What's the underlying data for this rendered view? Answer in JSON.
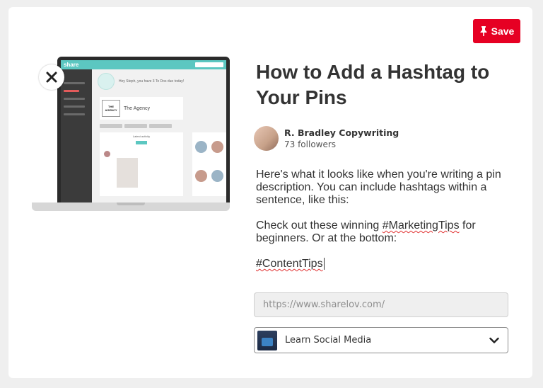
{
  "save_button": {
    "label": "Save"
  },
  "pin": {
    "title": "How to Add a Hashtag to Your Pins",
    "author": {
      "name": "R. Bradley Copywriting",
      "followers": "73 followers"
    },
    "description": {
      "p1": "Here's what it looks like when you're writing a pin description. You can include hashtags within a sentence, like this:",
      "p2_before": "Check out these winning ",
      "p2_hashtag": "#MarketingTips",
      "p2_after": " for beginners. Or at the bottom:",
      "p3_hashtag": "#ContentTips"
    }
  },
  "preview": {
    "app_logo": "share",
    "greeting": "Hey Steph, you have 3 To Dos due today!",
    "agency_logo": "THE AGENCY",
    "agency_name": "The Agency",
    "activity_title": "Latest activity"
  },
  "url_field": {
    "placeholder": "https://www.sharelov.com/",
    "value": ""
  },
  "board_select": {
    "selected": "Learn Social Media"
  },
  "colors": {
    "save_red": "#e60023",
    "app_teal": "#5cc7c1"
  },
  "icons": {
    "save": "pin-icon",
    "close": "close-icon",
    "dropdown": "chevron-down-icon"
  }
}
